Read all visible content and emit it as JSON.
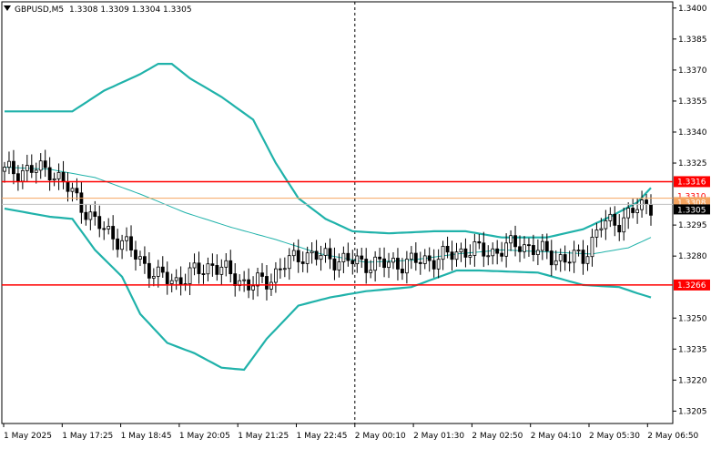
{
  "header": {
    "symbol": "GBPUSD,M5",
    "ohlc": "1.3308 1.3309 1.3304 1.3305"
  },
  "colors": {
    "candle": "#000000",
    "bollinger": "#20b2aa",
    "ma": "#20b2aa",
    "level": "#ff0000",
    "level_orange": "#f4a460",
    "price_tag_bg": "#000000",
    "grid": "#c0c0c0"
  },
  "chart_data": {
    "type": "candlestick",
    "grid": true,
    "y_ticks": [
      "1.3400",
      "1.3385",
      "1.3370",
      "1.3355",
      "1.3340",
      "1.3325",
      "1.3295",
      "1.3280",
      "1.3250",
      "1.3235",
      "1.3220",
      "1.3205"
    ],
    "y_range": [
      1.3199,
      1.3403
    ],
    "x_ticks": [
      "1 May 2025",
      "1 May 17:25",
      "1 May 18:45",
      "1 May 20:05",
      "1 May 21:25",
      "1 May 22:45",
      "2 May 00:10",
      "2 May 01:30",
      "2 May 02:50",
      "2 May 04:10",
      "2 May 05:30",
      "2 May 06:50"
    ],
    "n_bars": 144,
    "levels": [
      {
        "value": 1.3316,
        "label": "1.3316",
        "kind": "resistance"
      },
      {
        "value": 1.3266,
        "label": "1.3266",
        "kind": "support"
      }
    ],
    "price_tags": [
      {
        "value": 1.331,
        "label": "1.3310"
      },
      {
        "value": 1.3308,
        "label": "1.3308"
      },
      {
        "value": 1.3305,
        "label": "1.3305"
      }
    ],
    "orange_line": 1.3308,
    "current_price": 1.3305,
    "vertical_marker_x": "2 May 00:10",
    "close_path": [
      [
        0,
        1.3321
      ],
      [
        10,
        1.3322
      ],
      [
        16,
        1.3308
      ],
      [
        20,
        1.3296
      ],
      [
        26,
        1.3287
      ],
      [
        30,
        1.3278
      ],
      [
        34,
        1.327
      ],
      [
        38,
        1.3268
      ],
      [
        42,
        1.3272
      ],
      [
        46,
        1.3276
      ],
      [
        50,
        1.3271
      ],
      [
        54,
        1.3266
      ],
      [
        58,
        1.3268
      ],
      [
        62,
        1.3276
      ],
      [
        66,
        1.3281
      ],
      [
        72,
        1.3279
      ],
      [
        78,
        1.3277
      ],
      [
        84,
        1.3276
      ],
      [
        90,
        1.3277
      ],
      [
        96,
        1.3279
      ],
      [
        102,
        1.3283
      ],
      [
        108,
        1.3282
      ],
      [
        114,
        1.3286
      ],
      [
        120,
        1.3281
      ],
      [
        124,
        1.3278
      ],
      [
        128,
        1.328
      ],
      [
        132,
        1.3295
      ],
      [
        136,
        1.3297
      ],
      [
        140,
        1.3303
      ],
      [
        143,
        1.3305
      ]
    ],
    "bollinger_upper": [
      [
        0,
        1.335
      ],
      [
        15,
        1.335
      ],
      [
        22,
        1.336
      ],
      [
        30,
        1.3368
      ],
      [
        34,
        1.3373
      ],
      [
        37,
        1.3373
      ],
      [
        41,
        1.3366
      ],
      [
        48,
        1.3357
      ],
      [
        55,
        1.3346
      ],
      [
        60,
        1.3325
      ],
      [
        65,
        1.3308
      ],
      [
        71,
        1.3298
      ],
      [
        77,
        1.3292
      ],
      [
        85,
        1.3291
      ],
      [
        95,
        1.3292
      ],
      [
        102,
        1.3292
      ],
      [
        110,
        1.3289
      ],
      [
        120,
        1.3289
      ],
      [
        128,
        1.3293
      ],
      [
        134,
        1.3299
      ],
      [
        140,
        1.3306
      ],
      [
        143,
        1.3313
      ]
    ],
    "bollinger_middle": [
      [
        0,
        1.3323
      ],
      [
        10,
        1.3322
      ],
      [
        20,
        1.3318
      ],
      [
        30,
        1.331
      ],
      [
        40,
        1.3301
      ],
      [
        50,
        1.3294
      ],
      [
        60,
        1.3288
      ],
      [
        70,
        1.3281
      ],
      [
        80,
        1.3277
      ],
      [
        90,
        1.3278
      ],
      [
        100,
        1.3281
      ],
      [
        110,
        1.3283
      ],
      [
        120,
        1.3282
      ],
      [
        130,
        1.3281
      ],
      [
        138,
        1.3284
      ],
      [
        143,
        1.3289
      ]
    ],
    "bollinger_lower": [
      [
        0,
        1.3303
      ],
      [
        10,
        1.3299
      ],
      [
        15,
        1.3298
      ],
      [
        20,
        1.3283
      ],
      [
        26,
        1.327
      ],
      [
        30,
        1.3252
      ],
      [
        36,
        1.3238
      ],
      [
        42,
        1.3233
      ],
      [
        48,
        1.3226
      ],
      [
        53,
        1.3225
      ],
      [
        58,
        1.324
      ],
      [
        65,
        1.3256
      ],
      [
        72,
        1.326
      ],
      [
        80,
        1.3263
      ],
      [
        90,
        1.3265
      ],
      [
        100,
        1.3273
      ],
      [
        105,
        1.3273
      ],
      [
        118,
        1.3272
      ],
      [
        128,
        1.3266
      ],
      [
        136,
        1.3265
      ],
      [
        140,
        1.3262
      ],
      [
        143,
        1.326
      ]
    ]
  }
}
